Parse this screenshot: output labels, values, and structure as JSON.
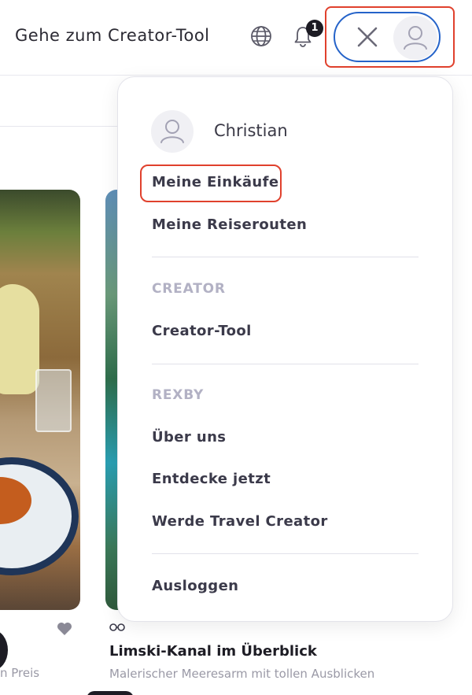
{
  "header": {
    "creator_link": "Gehe zum Creator-Tool",
    "notification_count": "1",
    "icons": [
      "globe-icon",
      "bell-icon",
      "close-icon",
      "user-icon"
    ]
  },
  "menu": {
    "user_name": "Christian",
    "items_top": [
      {
        "label": "Meine Einkäufe"
      },
      {
        "label": "Meine Reiserouten"
      }
    ],
    "section_creator": "CREATOR",
    "creator_items": [
      {
        "label": "Creator-Tool"
      }
    ],
    "section_rexby": "REXBY",
    "rexby_items": [
      {
        "label": "Über uns"
      },
      {
        "label": "Entdecke jetzt"
      },
      {
        "label": "Werde Travel Creator"
      }
    ],
    "logout": "Ausloggen"
  },
  "background": {
    "left_card_subtitle": "n Preis",
    "right_card_title": "Limski-Kanal im Überblick",
    "right_card_subtitle": "Malerischer Meeresarm mit tollen Ausblicken"
  },
  "colors": {
    "highlight_red": "#e0412d",
    "focus_blue": "#2563c9",
    "section_gray": "#b2b1c4",
    "text_dark": "#3b3a4a"
  }
}
